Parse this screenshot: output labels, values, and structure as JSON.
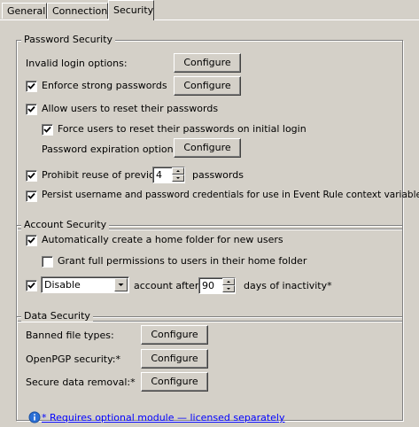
{
  "tabs": [
    "General",
    "Connections",
    "Security"
  ],
  "password_security": {
    "title": "Password Security",
    "invalid_login_label": "Invalid login options:",
    "configure_label": "Configure",
    "enforce_strong_label": "Enforce strong passwords",
    "enforce_strong_checked": true,
    "allow_reset_label": "Allow users to reset their passwords",
    "allow_reset_checked": true,
    "force_reset_label": "Force users to reset their passwords on initial login",
    "force_reset_checked": true,
    "expiration_label": "Password expiration options:*",
    "prohibit_reuse_label": "Prohibit reuse of previous",
    "prohibit_reuse_checked": true,
    "prohibit_reuse_value": "4",
    "passwords_suffix": "passwords",
    "persist_label": "Persist username and password credentials for use in Event Rule context variables",
    "persist_checked": true
  },
  "account_security": {
    "title": "Account Security",
    "auto_home_label": "Automatically create a home folder for new users",
    "auto_home_checked": true,
    "grant_full_label": "Grant full permissions to users in their home folder",
    "grant_full_checked": false,
    "inactivity_checked": true,
    "inactivity_action": "Disable",
    "account_after_label": "account after",
    "inactivity_days": "90",
    "days_label": "days of inactivity*"
  },
  "data_security": {
    "title": "Data Security",
    "banned_label": "Banned file types:",
    "openpgp_label": "OpenPGP security:*",
    "secure_removal_label": "Secure data removal:*",
    "configure_label": "Configure"
  },
  "footer": {
    "note": "* Requires optional module — licensed separately"
  }
}
